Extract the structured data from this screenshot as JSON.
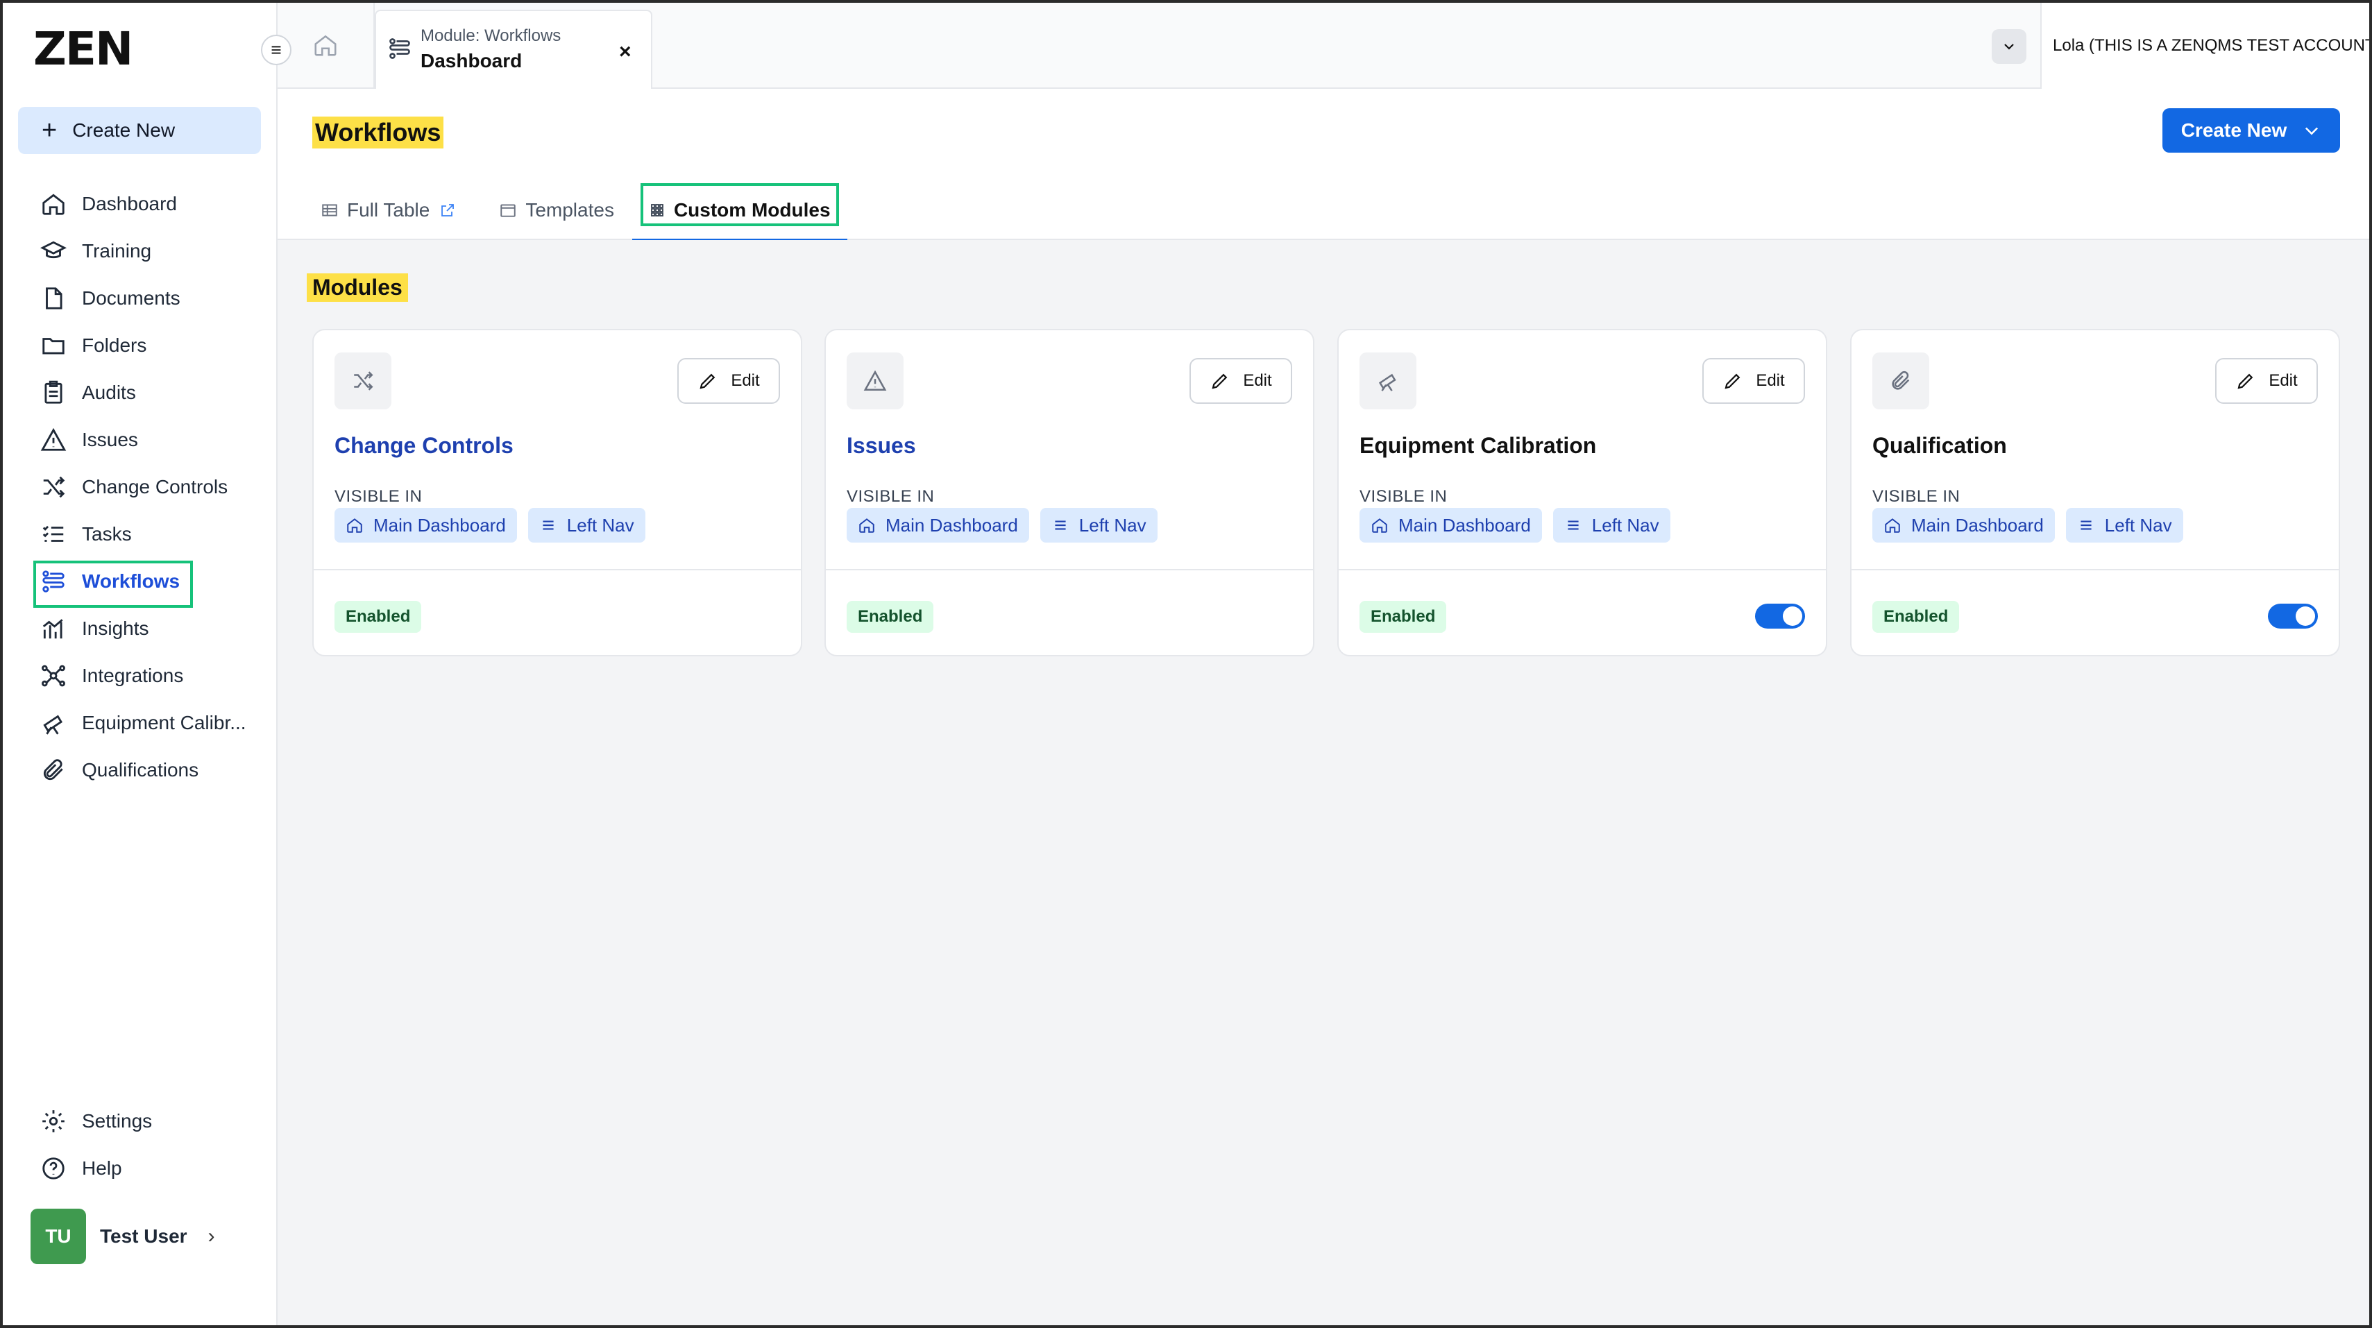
{
  "brand": {
    "logo": "ZEN"
  },
  "sidebar": {
    "create_new_label": "Create New",
    "items": [
      {
        "label": "Dashboard",
        "icon": "home-icon"
      },
      {
        "label": "Training",
        "icon": "graduation-cap-icon"
      },
      {
        "label": "Documents",
        "icon": "document-icon"
      },
      {
        "label": "Folders",
        "icon": "folder-icon"
      },
      {
        "label": "Audits",
        "icon": "clipboard-icon"
      },
      {
        "label": "Issues",
        "icon": "warning-triangle-icon"
      },
      {
        "label": "Change Controls",
        "icon": "shuffle-icon"
      },
      {
        "label": "Tasks",
        "icon": "checklist-icon"
      },
      {
        "label": "Workflows",
        "icon": "workflow-icon",
        "active": true
      },
      {
        "label": "Insights",
        "icon": "bar-chart-icon"
      },
      {
        "label": "Integrations",
        "icon": "network-icon"
      },
      {
        "label": "Equipment Calibr...",
        "icon": "telescope-icon"
      },
      {
        "label": "Qualifications",
        "icon": "paperclip-icon"
      }
    ],
    "bottom_items": [
      {
        "label": "Settings",
        "icon": "gear-icon"
      },
      {
        "label": "Help",
        "icon": "help-circle-icon"
      }
    ],
    "user": {
      "initials": "TU",
      "name": "Test User"
    }
  },
  "topbar": {
    "module_tab": {
      "subtitle": "Module: Workflows",
      "title": "Dashboard",
      "close": "×"
    },
    "account_name": "Lola (THIS IS A ZENQMS TEST ACCOUNT)"
  },
  "header": {
    "title": "Workflows",
    "create_new_label": "Create New",
    "tabs": [
      {
        "label": "Full Table",
        "icon": "table-icon"
      },
      {
        "label": "Templates",
        "icon": "calendar-icon"
      },
      {
        "label": "Custom Modules",
        "icon": "grid-icon",
        "active": true
      }
    ]
  },
  "content": {
    "section_title": "Modules",
    "edit_label": "Edit",
    "visible_in_label": "VISIBLE IN",
    "chips": {
      "main_dashboard": "Main Dashboard",
      "left_nav": "Left Nav"
    },
    "cards": [
      {
        "name": "Change Controls",
        "icon": "shuffle-icon",
        "status": "Enabled",
        "toggle": false
      },
      {
        "name": "Issues",
        "icon": "warning-triangle-icon",
        "status": "Enabled",
        "toggle": false
      },
      {
        "name": "Equipment Calibration",
        "icon": "telescope-icon",
        "status": "Enabled",
        "toggle": true
      },
      {
        "name": "Qualification",
        "icon": "paperclip-icon",
        "status": "Enabled",
        "toggle": true
      }
    ]
  },
  "colors": {
    "accent": "#1268e3",
    "highlight_yellow": "#fde047",
    "annotation_green": "#16c27a",
    "chip_bg": "#dbeafe",
    "badge_bg": "#dcfce7"
  }
}
